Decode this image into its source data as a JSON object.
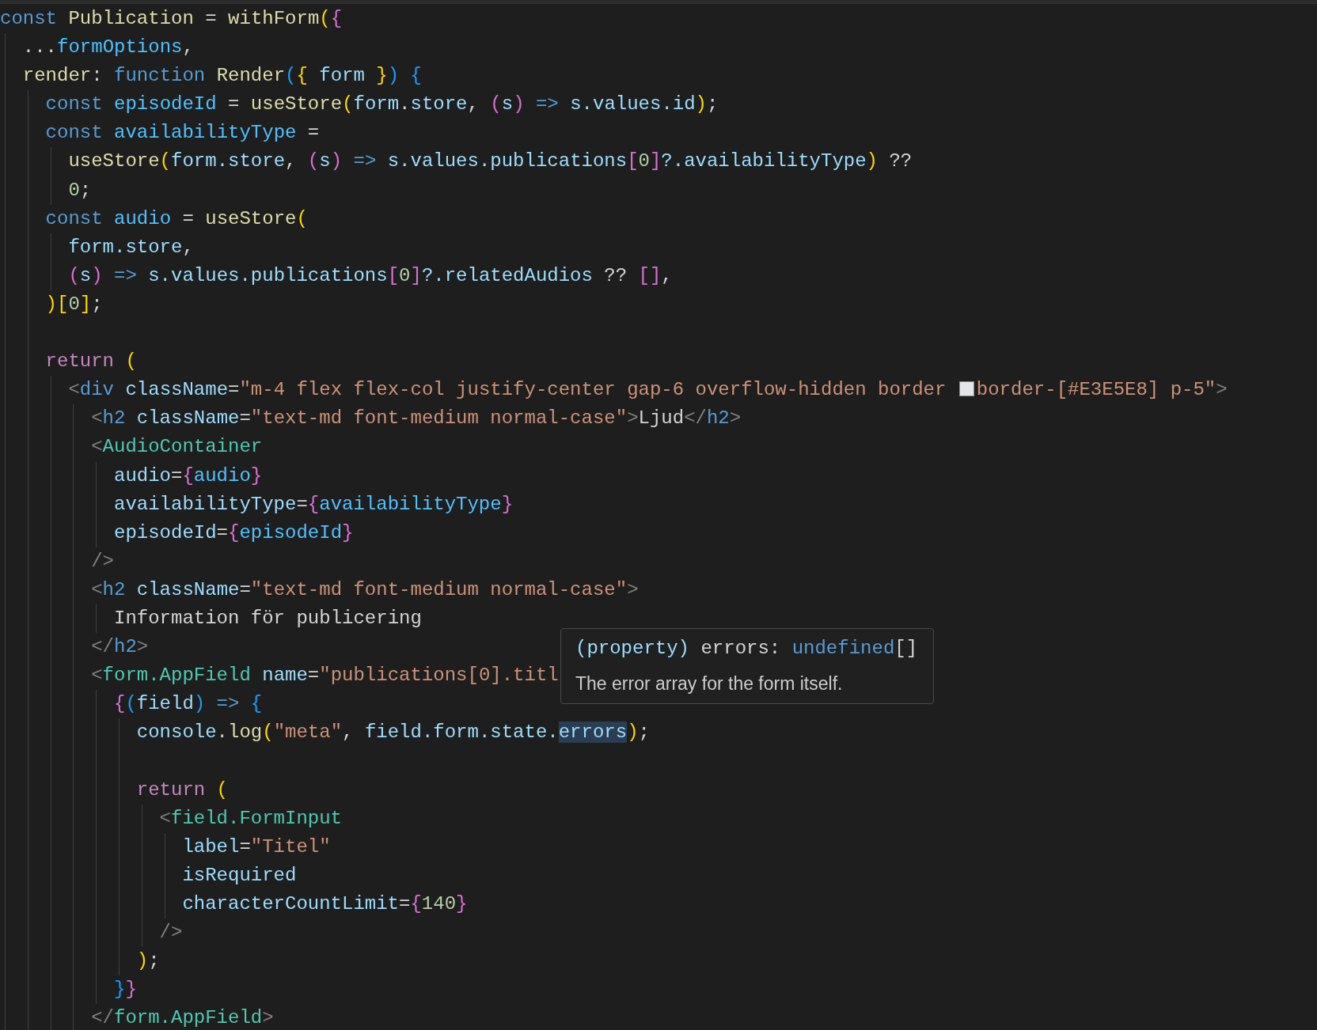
{
  "editor": {
    "lines": [
      {
        "kind": "code",
        "tokens": [
          {
            "kind": "kw",
            "text": "const "
          },
          {
            "kind": "fn",
            "text": "Publication"
          },
          {
            "kind": "plain",
            "text": " = "
          },
          {
            "kind": "fn",
            "text": "withForm"
          },
          {
            "kind": "b1",
            "text": "("
          },
          {
            "kind": "b2",
            "text": "{"
          }
        ]
      },
      {
        "kind": "code",
        "tokens": [
          {
            "kind": "plain",
            "text": "  ..."
          },
          {
            "kind": "const",
            "text": "formOptions"
          },
          {
            "kind": "plain",
            "text": ","
          }
        ]
      },
      {
        "kind": "code",
        "tokens": [
          {
            "kind": "fn",
            "text": "  render"
          },
          {
            "kind": "plain",
            "text": ": "
          },
          {
            "kind": "kw",
            "text": "function "
          },
          {
            "kind": "fn",
            "text": "Render"
          },
          {
            "kind": "b3",
            "text": "("
          },
          {
            "kind": "b1",
            "text": "{ "
          },
          {
            "kind": "var",
            "text": "form"
          },
          {
            "kind": "b1",
            "text": " }"
          },
          {
            "kind": "b3",
            "text": ")"
          },
          {
            "kind": "b3",
            "text": " {"
          }
        ]
      },
      {
        "kind": "code",
        "tokens": [
          {
            "kind": "kw",
            "text": "    const "
          },
          {
            "kind": "const",
            "text": "episodeId"
          },
          {
            "kind": "plain",
            "text": " = "
          },
          {
            "kind": "fn",
            "text": "useStore"
          },
          {
            "kind": "b1",
            "text": "("
          },
          {
            "kind": "var",
            "text": "form"
          },
          {
            "kind": "plain",
            "text": "."
          },
          {
            "kind": "var",
            "text": "store"
          },
          {
            "kind": "plain",
            "text": ", "
          },
          {
            "kind": "b2",
            "text": "("
          },
          {
            "kind": "var",
            "text": "s"
          },
          {
            "kind": "b2",
            "text": ")"
          },
          {
            "kind": "kw",
            "text": " =>"
          },
          {
            "kind": "var",
            "text": " s.values.id"
          },
          {
            "kind": "b1",
            "text": ")"
          },
          {
            "kind": "plain",
            "text": ";"
          }
        ]
      },
      {
        "kind": "code",
        "tokens": [
          {
            "kind": "kw",
            "text": "    const "
          },
          {
            "kind": "const",
            "text": "availabilityType"
          },
          {
            "kind": "plain",
            "text": " ="
          }
        ]
      },
      {
        "kind": "code",
        "tokens": [
          {
            "kind": "fn",
            "text": "      useStore"
          },
          {
            "kind": "b1",
            "text": "("
          },
          {
            "kind": "var",
            "text": "form.store"
          },
          {
            "kind": "plain",
            "text": ", "
          },
          {
            "kind": "b2",
            "text": "("
          },
          {
            "kind": "var",
            "text": "s"
          },
          {
            "kind": "b2",
            "text": ")"
          },
          {
            "kind": "kw",
            "text": " => "
          },
          {
            "kind": "var",
            "text": "s.values.publications"
          },
          {
            "kind": "b2",
            "text": "["
          },
          {
            "kind": "num",
            "text": "0"
          },
          {
            "kind": "b2",
            "text": "]"
          },
          {
            "kind": "var",
            "text": "?.availabilityType"
          },
          {
            "kind": "b1",
            "text": ")"
          },
          {
            "kind": "plain",
            "text": " ??"
          }
        ]
      },
      {
        "kind": "code",
        "tokens": [
          {
            "kind": "num",
            "text": "      0"
          },
          {
            "kind": "plain",
            "text": ";"
          }
        ]
      },
      {
        "kind": "code",
        "tokens": [
          {
            "kind": "kw",
            "text": "    const "
          },
          {
            "kind": "const",
            "text": "audio"
          },
          {
            "kind": "plain",
            "text": " = "
          },
          {
            "kind": "fn",
            "text": "useStore"
          },
          {
            "kind": "b1",
            "text": "("
          }
        ]
      },
      {
        "kind": "code",
        "tokens": [
          {
            "kind": "var",
            "text": "      form.store"
          },
          {
            "kind": "plain",
            "text": ","
          }
        ]
      },
      {
        "kind": "code",
        "tokens": [
          {
            "kind": "b2",
            "text": "      ("
          },
          {
            "kind": "var",
            "text": "s"
          },
          {
            "kind": "b2",
            "text": ")"
          },
          {
            "kind": "kw",
            "text": " => "
          },
          {
            "kind": "var",
            "text": "s.values.publications"
          },
          {
            "kind": "b2",
            "text": "["
          },
          {
            "kind": "num",
            "text": "0"
          },
          {
            "kind": "b2",
            "text": "]"
          },
          {
            "kind": "var",
            "text": "?.relatedAudios"
          },
          {
            "kind": "plain",
            "text": " ?? "
          },
          {
            "kind": "b2",
            "text": "[]"
          },
          {
            "kind": "plain",
            "text": ","
          }
        ]
      },
      {
        "kind": "code",
        "tokens": [
          {
            "kind": "b1",
            "text": "    )["
          },
          {
            "kind": "num",
            "text": "0"
          },
          {
            "kind": "b1",
            "text": "]"
          },
          {
            "kind": "plain",
            "text": ";"
          }
        ]
      },
      {
        "kind": "blank"
      },
      {
        "kind": "code",
        "tokens": [
          {
            "kind": "ctl",
            "text": "    return "
          },
          {
            "kind": "b1",
            "text": "("
          }
        ]
      },
      {
        "kind": "code",
        "tokens": [
          {
            "kind": "punct",
            "text": "      <"
          },
          {
            "kind": "tag",
            "text": "div"
          },
          {
            "kind": "var",
            "text": " className"
          },
          {
            "kind": "plain",
            "text": "="
          },
          {
            "kind": "str",
            "text": "\"m-4 flex flex-col justify-center gap-6 overflow-hidden border "
          },
          {
            "kind": "swatch"
          },
          {
            "kind": "str",
            "text": "border-[#E3E5E8] p-5\""
          },
          {
            "kind": "punct",
            "text": ">"
          }
        ]
      },
      {
        "kind": "code",
        "tokens": [
          {
            "kind": "punct",
            "text": "        <"
          },
          {
            "kind": "tag",
            "text": "h2"
          },
          {
            "kind": "var",
            "text": " className"
          },
          {
            "kind": "plain",
            "text": "="
          },
          {
            "kind": "str",
            "text": "\"text-md font-medium normal-case\""
          },
          {
            "kind": "punct",
            "text": ">"
          },
          {
            "kind": "plain",
            "text": "Ljud"
          },
          {
            "kind": "punct",
            "text": "</"
          },
          {
            "kind": "tag",
            "text": "h2"
          },
          {
            "kind": "punct",
            "text": ">"
          }
        ]
      },
      {
        "kind": "code",
        "tokens": [
          {
            "kind": "punct",
            "text": "        <"
          },
          {
            "kind": "comp",
            "text": "AudioContainer"
          }
        ]
      },
      {
        "kind": "code",
        "tokens": [
          {
            "kind": "var",
            "text": "          audio"
          },
          {
            "kind": "plain",
            "text": "="
          },
          {
            "kind": "b2",
            "text": "{"
          },
          {
            "kind": "const",
            "text": "audio"
          },
          {
            "kind": "b2",
            "text": "}"
          }
        ]
      },
      {
        "kind": "code",
        "tokens": [
          {
            "kind": "var",
            "text": "          availabilityType"
          },
          {
            "kind": "plain",
            "text": "="
          },
          {
            "kind": "b2",
            "text": "{"
          },
          {
            "kind": "const",
            "text": "availabilityType"
          },
          {
            "kind": "b2",
            "text": "}"
          }
        ]
      },
      {
        "kind": "code",
        "tokens": [
          {
            "kind": "var",
            "text": "          episodeId"
          },
          {
            "kind": "plain",
            "text": "="
          },
          {
            "kind": "b2",
            "text": "{"
          },
          {
            "kind": "const",
            "text": "episodeId"
          },
          {
            "kind": "b2",
            "text": "}"
          }
        ]
      },
      {
        "kind": "code",
        "tokens": [
          {
            "kind": "punct",
            "text": "        />"
          }
        ]
      },
      {
        "kind": "code",
        "tokens": [
          {
            "kind": "punct",
            "text": "        <"
          },
          {
            "kind": "tag",
            "text": "h2"
          },
          {
            "kind": "var",
            "text": " className"
          },
          {
            "kind": "plain",
            "text": "="
          },
          {
            "kind": "str",
            "text": "\"text-md font-medium normal-case\""
          },
          {
            "kind": "punct",
            "text": ">"
          }
        ]
      },
      {
        "kind": "code",
        "tokens": [
          {
            "kind": "plain",
            "text": "          Information för publicering"
          }
        ]
      },
      {
        "kind": "code",
        "tokens": [
          {
            "kind": "punct",
            "text": "        </"
          },
          {
            "kind": "tag",
            "text": "h2"
          },
          {
            "kind": "punct",
            "text": ">"
          }
        ]
      },
      {
        "kind": "code",
        "tokens": [
          {
            "kind": "punct",
            "text": "        <"
          },
          {
            "kind": "comp",
            "text": "form.AppField"
          },
          {
            "kind": "var",
            "text": " name"
          },
          {
            "kind": "plain",
            "text": "="
          },
          {
            "kind": "str",
            "text": "\"publications[0].titl"
          }
        ]
      },
      {
        "kind": "code",
        "tokens": [
          {
            "kind": "b2",
            "text": "          {"
          },
          {
            "kind": "b3",
            "text": "("
          },
          {
            "kind": "var",
            "text": "field"
          },
          {
            "kind": "b3",
            "text": ")"
          },
          {
            "kind": "kw",
            "text": " => "
          },
          {
            "kind": "b3",
            "text": "{"
          }
        ]
      },
      {
        "kind": "code",
        "tokens": [
          {
            "kind": "var",
            "text": "            console"
          },
          {
            "kind": "plain",
            "text": "."
          },
          {
            "kind": "fn",
            "text": "log"
          },
          {
            "kind": "b1",
            "text": "("
          },
          {
            "kind": "str",
            "text": "\"meta\""
          },
          {
            "kind": "plain",
            "text": ", "
          },
          {
            "kind": "var",
            "text": "field.form.state."
          },
          {
            "kind": "var",
            "text": "errors",
            "highlighted": true
          },
          {
            "kind": "b1",
            "text": ")"
          },
          {
            "kind": "plain",
            "text": ";"
          }
        ]
      },
      {
        "kind": "blank"
      },
      {
        "kind": "code",
        "tokens": [
          {
            "kind": "ctl",
            "text": "            return "
          },
          {
            "kind": "b1",
            "text": "("
          }
        ]
      },
      {
        "kind": "code",
        "tokens": [
          {
            "kind": "punct",
            "text": "              <"
          },
          {
            "kind": "comp",
            "text": "field.FormInput"
          }
        ]
      },
      {
        "kind": "code",
        "tokens": [
          {
            "kind": "var",
            "text": "                label"
          },
          {
            "kind": "plain",
            "text": "="
          },
          {
            "kind": "str",
            "text": "\"Titel\""
          }
        ]
      },
      {
        "kind": "code",
        "tokens": [
          {
            "kind": "var",
            "text": "                isRequired"
          }
        ]
      },
      {
        "kind": "code",
        "tokens": [
          {
            "kind": "var",
            "text": "                characterCountLimit"
          },
          {
            "kind": "plain",
            "text": "="
          },
          {
            "kind": "b2",
            "text": "{"
          },
          {
            "kind": "num",
            "text": "140"
          },
          {
            "kind": "b2",
            "text": "}"
          }
        ]
      },
      {
        "kind": "code",
        "tokens": [
          {
            "kind": "punct",
            "text": "              />"
          }
        ]
      },
      {
        "kind": "code",
        "tokens": [
          {
            "kind": "b1",
            "text": "            )"
          },
          {
            "kind": "plain",
            "text": ";"
          }
        ]
      },
      {
        "kind": "code",
        "tokens": [
          {
            "kind": "b3",
            "text": "          }"
          },
          {
            "kind": "b2",
            "text": "}"
          }
        ]
      },
      {
        "kind": "code",
        "tokens": [
          {
            "kind": "punct",
            "text": "        </"
          },
          {
            "kind": "comp",
            "text": "form.AppField"
          },
          {
            "kind": "punct",
            "text": ">"
          }
        ]
      }
    ]
  },
  "hover_tooltip": {
    "signature": [
      {
        "kind": "var",
        "text": "(property)"
      },
      {
        "kind": "plain",
        "text": " errors: "
      },
      {
        "kind": "kw",
        "text": "undefined"
      },
      {
        "kind": "plain",
        "text": "[]"
      }
    ],
    "description": "The error array for the form itself."
  }
}
